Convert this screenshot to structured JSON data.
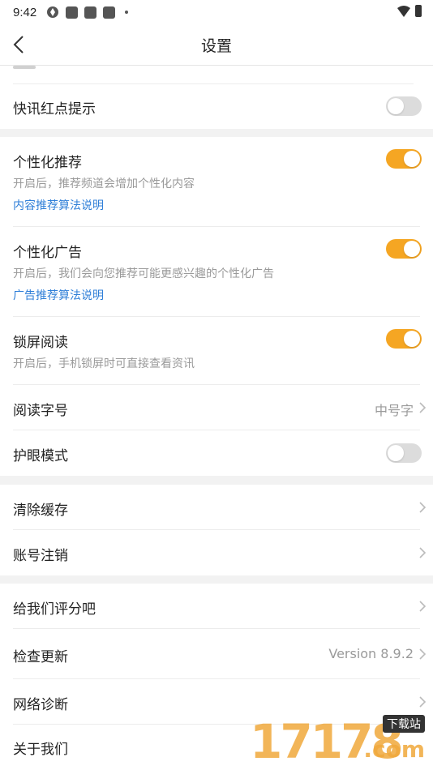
{
  "status_bar": {
    "time": "9:42"
  },
  "app_bar": {
    "title": "设置"
  },
  "sections": {
    "s1": {
      "kuaixun": {
        "label": "快讯红点提示",
        "toggle": "off"
      }
    },
    "s2": {
      "personal_rec": {
        "label": "个性化推荐",
        "sub": "开启后，推荐频道会增加个性化内容",
        "link": "内容推荐算法说明",
        "toggle": "on"
      },
      "personal_ad": {
        "label": "个性化广告",
        "sub": "开启后，我们会向您推荐可能更感兴趣的个性化广告",
        "link": "广告推荐算法说明",
        "toggle": "on"
      },
      "lockscreen": {
        "label": "锁屏阅读",
        "sub": "开启后，手机锁屏时可直接查看资讯",
        "toggle": "on"
      },
      "font_size": {
        "label": "阅读字号",
        "value": "中号字"
      },
      "eye_mode": {
        "label": "护眼模式",
        "toggle": "off"
      }
    },
    "s3": {
      "clear_cache": {
        "label": "清除缓存"
      },
      "cancel_account": {
        "label": "账号注销"
      }
    },
    "s4": {
      "rate_us": {
        "label": "给我们评分吧"
      },
      "check_update": {
        "label": "检查更新",
        "value": "Version 8.9.2"
      },
      "network_diag": {
        "label": "网络诊断"
      },
      "about_us": {
        "label": "关于我们"
      }
    }
  },
  "watermark": {
    "number": "17178",
    "badge": "下载站",
    "domain": ".com"
  },
  "colors": {
    "accent": "#f5a623",
    "link": "#2f7fd8",
    "section_gap": "#f2f2f2"
  }
}
